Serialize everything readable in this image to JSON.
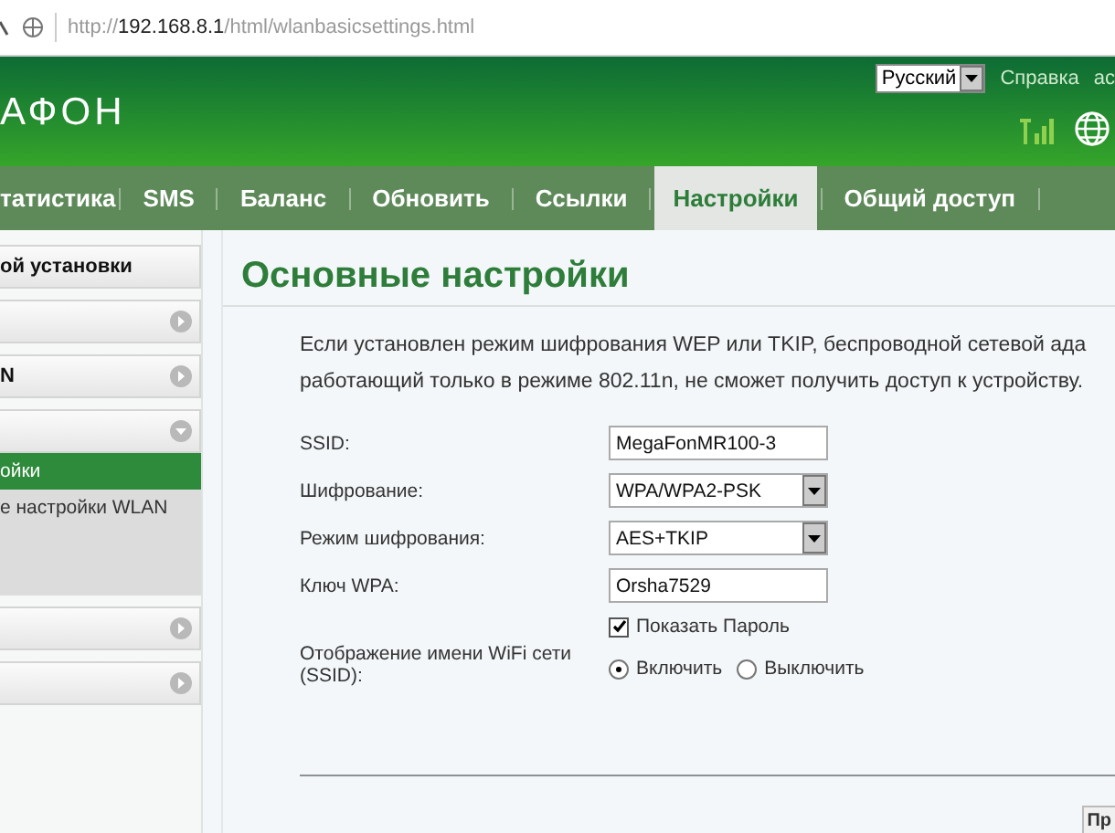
{
  "address_bar": {
    "url_host": "192.168.8.1",
    "url_prefix": "http://",
    "url_path": "/html/wlanbasicsettings.html"
  },
  "header": {
    "logo": "АФОН",
    "language": "Русский",
    "links": [
      "Справка",
      "ас"
    ]
  },
  "nav": [
    {
      "label": "татистика",
      "selected": false
    },
    {
      "label": "SMS",
      "selected": false
    },
    {
      "label": "Баланс",
      "selected": false
    },
    {
      "label": "Обновить",
      "selected": false
    },
    {
      "label": "Ссылки",
      "selected": false
    },
    {
      "label": "Настройки",
      "selected": true
    },
    {
      "label": "Общий доступ",
      "selected": false
    }
  ],
  "sidebar": [
    {
      "kind": "header",
      "label": "ой установки"
    },
    {
      "kind": "group",
      "expanded": false
    },
    {
      "kind": "group",
      "label": "N",
      "expanded": false
    },
    {
      "kind": "group",
      "expanded": true,
      "children": [
        {
          "label": "ойки",
          "selected": true
        },
        {
          "label": "е настройки WLAN",
          "selected": false
        }
      ]
    },
    {
      "kind": "group",
      "expanded": false
    },
    {
      "kind": "group",
      "expanded": false
    }
  ],
  "main": {
    "title": "Основные настройки",
    "notice_lines": [
      "Если установлен режим шифрования WEP или TKIP, беспроводной сетевой ада",
      "работающий только в режиме 802.11n, не сможет получить доступ к устройству."
    ],
    "fields": [
      {
        "kind": "text",
        "label": "SSID:",
        "value": "MegaFonMR100-3"
      },
      {
        "kind": "select",
        "label": "Шифрование:",
        "value": "WPA/WPA2-PSK"
      },
      {
        "kind": "select",
        "label": "Режим шифрования:",
        "value": "AES+TKIP"
      },
      {
        "kind": "text",
        "label": "Ключ WPA:",
        "value": "Orsha7529"
      }
    ],
    "show_password": {
      "label": "Показать Пароль",
      "checked": true
    },
    "ssid_broadcast": {
      "label": "Отображение имени WiFi сети (SSID):",
      "options": [
        {
          "label": "Включить",
          "selected": true
        },
        {
          "label": "Выключить",
          "selected": false
        }
      ]
    },
    "button": "Пр"
  }
}
